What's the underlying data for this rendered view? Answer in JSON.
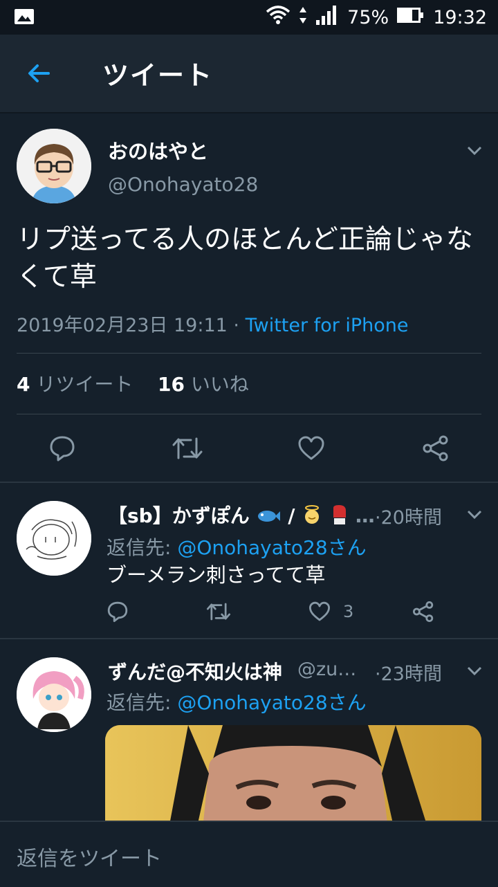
{
  "status_bar": {
    "battery": "75%",
    "time": "19:32"
  },
  "header": {
    "title": "ツイート"
  },
  "tweet": {
    "name": "おのはやと",
    "handle": "@Onohayato28",
    "text": "リプ送ってる人のほとんど正論じゃなくて草",
    "date": "2019年02月23日 19:11",
    "separator": "·",
    "via": "Twitter for iPhone",
    "retweet_count": "4",
    "retweet_label": "リツイート",
    "like_count": "16",
    "like_label": "いいね"
  },
  "replies": [
    {
      "name": "【sb】かずぽん",
      "name_suffix": "…",
      "time": "·20時間",
      "replying_label": "返信先:",
      "replying_to": "@Onohayato28さん",
      "text": "ブーメラン刺さってて草",
      "like_count": "3"
    },
    {
      "name": "ずんだ@不知火は神",
      "handle": "@zu…",
      "time": "·23時間",
      "replying_label": "返信先:",
      "replying_to": "@Onohayato28さん"
    }
  ],
  "compose": {
    "placeholder": "返信をツイート"
  },
  "colors": {
    "background": "#15202b",
    "header": "#1c2732",
    "accent": "#1da1f2",
    "muted": "#8899a6"
  }
}
